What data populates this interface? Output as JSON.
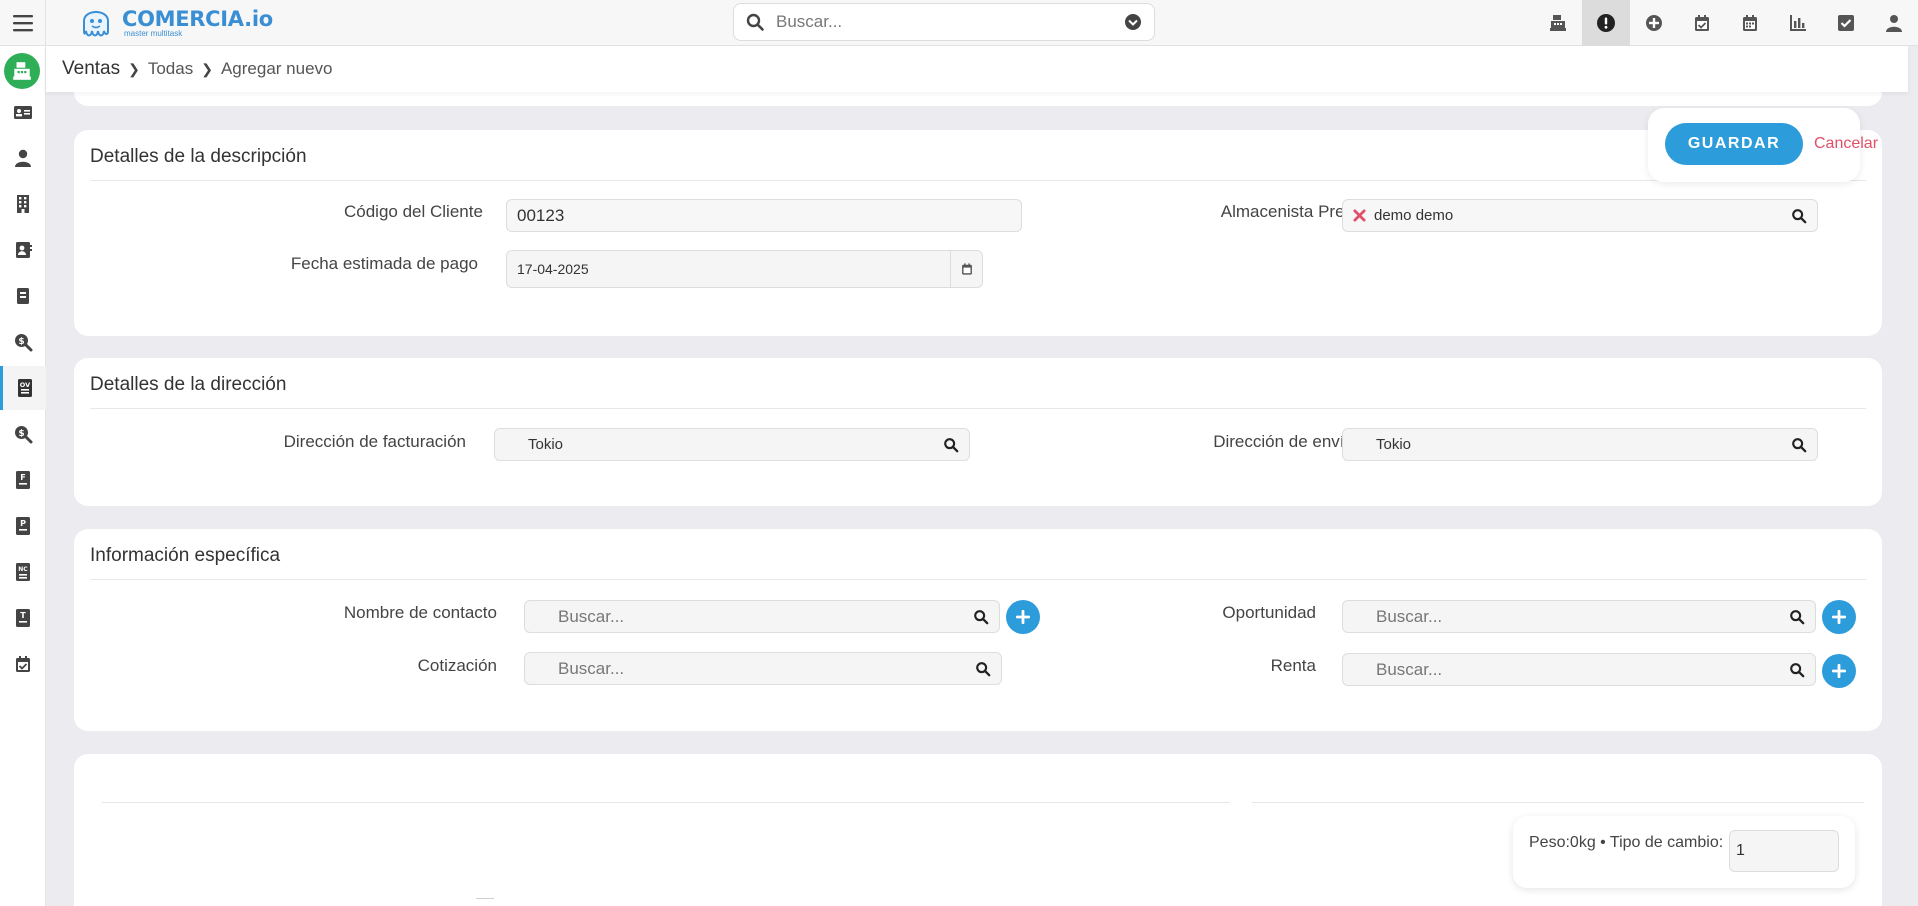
{
  "app": {
    "logo_name": "COMERCIA.io",
    "logo_sub": "master multitask"
  },
  "topbar": {
    "search_placeholder": "Buscar...",
    "icons": [
      "cash-register-icon",
      "alert-icon",
      "plus-circle-icon",
      "calendar-check-icon",
      "calendar-icon",
      "bar-chart-icon",
      "checkbox-icon",
      "user-icon"
    ],
    "active_icon": "alert-icon"
  },
  "sidebar": {
    "items": [
      "id-card-icon",
      "user-icon",
      "building-icon",
      "contact-card-icon",
      "book-icon",
      "search-dollar-icon",
      "sales-order-icon",
      "search-dollar-icon",
      "invoice-icon",
      "proforma-icon",
      "credit-note-icon",
      "ticket-icon",
      "calendar-check-icon"
    ],
    "active_index": 6,
    "active_label": "OV"
  },
  "breadcrumb": {
    "home": "Ventas",
    "items": [
      "Todas",
      "Agregar nuevo"
    ]
  },
  "actions": {
    "save_label": "GUARDAR",
    "cancel_label": "Cancelar"
  },
  "description": {
    "title": "Detalles de la descripción",
    "client_code_label": "Código del Cliente",
    "client_code_value": "00123",
    "payment_date_label": "Fecha estimada de pago",
    "payment_date_value": "17-04-2025",
    "warehouse_label": "Almacenista Pref.",
    "warehouse_value": "demo demo"
  },
  "address": {
    "title": "Detalles de la dirección",
    "billing_label": "Dirección de facturación",
    "billing_value": "Tokio",
    "shipping_label": "Dirección de envío",
    "shipping_value": "Tokio"
  },
  "specific": {
    "title": "Información específica",
    "contact_label": "Nombre de contacto",
    "contact_placeholder": "Buscar...",
    "opportunity_label": "Oportunidad",
    "opportunity_placeholder": "Buscar...",
    "quote_label": "Cotización",
    "quote_placeholder": "Buscar...",
    "rent_label": "Renta",
    "rent_placeholder": "Buscar..."
  },
  "totals": {
    "summary": "Peso:0kg • Tipo de cambio:",
    "exchange_rate": "1"
  },
  "colors": {
    "accent": "#2d9cdb",
    "danger": "#e0506a",
    "module": "#2fae58"
  }
}
